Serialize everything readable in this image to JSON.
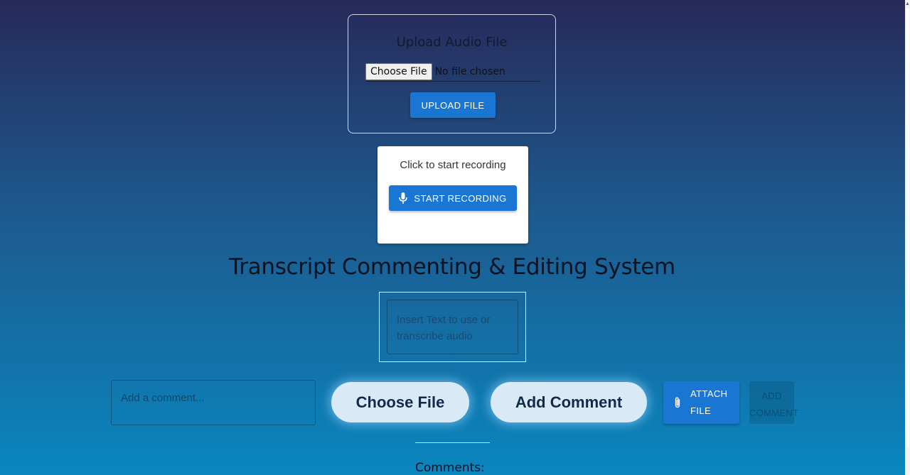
{
  "upload": {
    "title": "Upload Audio File",
    "choose_label": "Choose File",
    "no_file": "No file chosen",
    "upload_button": "UPLOAD FILE"
  },
  "recording": {
    "prompt": "Click to start recording",
    "button": "START RECORDING",
    "icon": "microphone-icon"
  },
  "page_title": "Transcript Commenting & Editing System",
  "transcript": {
    "placeholder": "Insert Text to use or transcribe audio"
  },
  "comment": {
    "placeholder": "Add a comment...",
    "choose_file": "Choose File",
    "add_comment": "Add Comment",
    "attach_line1": "ATTACH",
    "attach_line2": "FILE",
    "attach_icon": "paperclip-icon",
    "add_disabled_line1": "ADD",
    "add_disabled_line2": "COMMENT"
  },
  "comments_heading": "Comments:",
  "colors": {
    "accent": "#1976d2",
    "background_top": "#27295a",
    "background_bottom": "#0a86bf",
    "pill": "#d9eaf6"
  }
}
